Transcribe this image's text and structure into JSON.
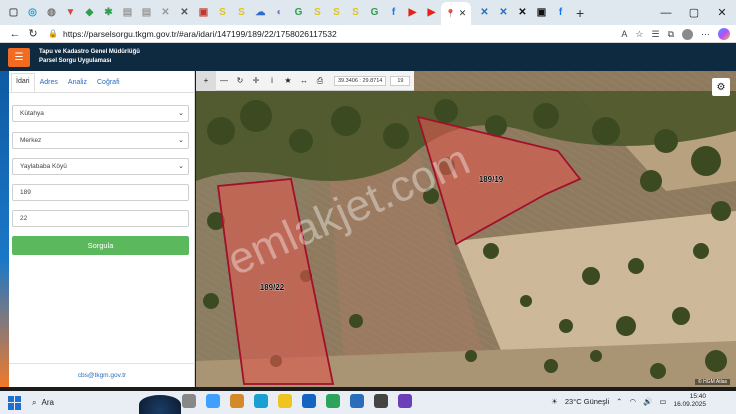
{
  "browser": {
    "tab_icons": [
      {
        "name": "window-icon",
        "color": "#555555",
        "glyph": "▢"
      },
      {
        "name": "edge-icon",
        "color": "#1aa0d0",
        "glyph": "◎"
      },
      {
        "name": "globe-icon",
        "color": "#777777",
        "glyph": "◍"
      },
      {
        "name": "shield-icon",
        "color": "#d44444",
        "glyph": "▼"
      },
      {
        "name": "puzzle-icon",
        "color": "#2e9d4c",
        "glyph": "◆"
      },
      {
        "name": "gear-icon",
        "color": "#2e9d4c",
        "glyph": "✱"
      },
      {
        "name": "doc-icon",
        "color": "#999999",
        "glyph": "▤"
      },
      {
        "name": "doc-icon",
        "color": "#999999",
        "glyph": "▤"
      },
      {
        "name": "close-box-icon",
        "color": "#999999",
        "glyph": "✕"
      },
      {
        "name": "close-box-icon",
        "color": "#555555",
        "glyph": "✕"
      },
      {
        "name": "news-icon",
        "color": "#c0392b",
        "glyph": "▣"
      },
      {
        "name": "sahibinden-icon",
        "color": "#e3c515",
        "glyph": "S"
      },
      {
        "name": "sahibinden-icon",
        "color": "#e3c515",
        "glyph": "S"
      },
      {
        "name": "cloud-icon",
        "color": "#2d6bd1",
        "glyph": "☁"
      },
      {
        "name": "shield-icon",
        "color": "#8866cc",
        "glyph": "◐"
      },
      {
        "name": "g-icon",
        "color": "#2e9d4c",
        "glyph": "G"
      },
      {
        "name": "sahibinden-icon",
        "color": "#e3c515",
        "glyph": "S"
      },
      {
        "name": "sahibinden-icon",
        "color": "#e3c515",
        "glyph": "S"
      },
      {
        "name": "sahibinden-icon",
        "color": "#e3c515",
        "glyph": "S"
      },
      {
        "name": "g-icon",
        "color": "#2e9d4c",
        "glyph": "G"
      },
      {
        "name": "facebook-icon",
        "color": "#1877f2",
        "glyph": "f"
      },
      {
        "name": "youtube-icon",
        "color": "#e62117",
        "glyph": "▶"
      },
      {
        "name": "youtube-icon",
        "color": "#e62117",
        "glyph": "▶"
      }
    ],
    "tab_icons_after": [
      {
        "name": "close-x-icon",
        "color": "#2a6ebb",
        "glyph": "✕"
      },
      {
        "name": "close-x-icon",
        "color": "#2a6ebb",
        "glyph": "✕"
      },
      {
        "name": "close-x-icon",
        "color": "#111111",
        "glyph": "✕"
      },
      {
        "name": "tv-icon",
        "color": "#111111",
        "glyph": "▣"
      },
      {
        "name": "facebook-icon",
        "color": "#1877f2",
        "glyph": "f"
      }
    ],
    "url": "https://parselsorgu.tkgm.gov.tr/#ara/idari/147199/189/22/1758026117532"
  },
  "header": {
    "title_line1": "Tapu ve Kadastro Genel Müdürlüğü",
    "title_line2": "Parsel Sorgu Uygulaması"
  },
  "panel": {
    "tabs": [
      "İdari",
      "Adres",
      "Analiz",
      "Coğrafi"
    ],
    "province": "Kütahya",
    "district": "Merkez",
    "neighborhood": "Yaylababa Köyü",
    "block": "189",
    "parcel": "22",
    "query_button": "Sorgula",
    "contact": "cbs@tkgm.gov.tr"
  },
  "map": {
    "coords": "39.3406 : 29.8714",
    "zoom": "19",
    "parcel_a": "189/22",
    "parcel_b": "189/19",
    "watermark": "emlakjet.com",
    "attribution": "© HGM Atlas",
    "parcel_fill": "#e0584f",
    "parcel_stroke": "#a1102a"
  },
  "taskbar": {
    "search": "Ara",
    "weather": "23°C  Güneşli",
    "time": "15:40",
    "date": "16.09.2025"
  }
}
